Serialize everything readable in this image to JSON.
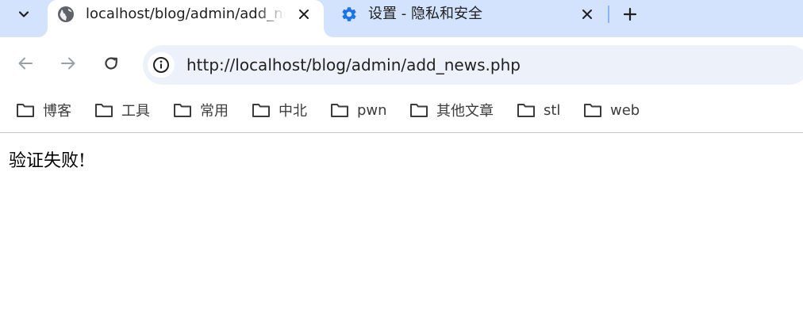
{
  "tabs": [
    {
      "title": "localhost/blog/admin/add_news.php",
      "active": true,
      "icon": "globe-icon"
    },
    {
      "title": "设置 - 隐私和安全",
      "active": false,
      "icon": "gear-icon"
    }
  ],
  "toolbar": {
    "url": "http://localhost/blog/admin/add_news.php"
  },
  "bookmarks": [
    "博客",
    "工具",
    "常用",
    "中北",
    "pwn",
    "其他文章",
    "stl",
    "web"
  ],
  "page": {
    "message": "验证失败!"
  },
  "colors": {
    "tabstrip_bg": "#d3e3fd",
    "omnibox_bg": "#edf2fa",
    "gear_icon": "#1a73e8"
  }
}
